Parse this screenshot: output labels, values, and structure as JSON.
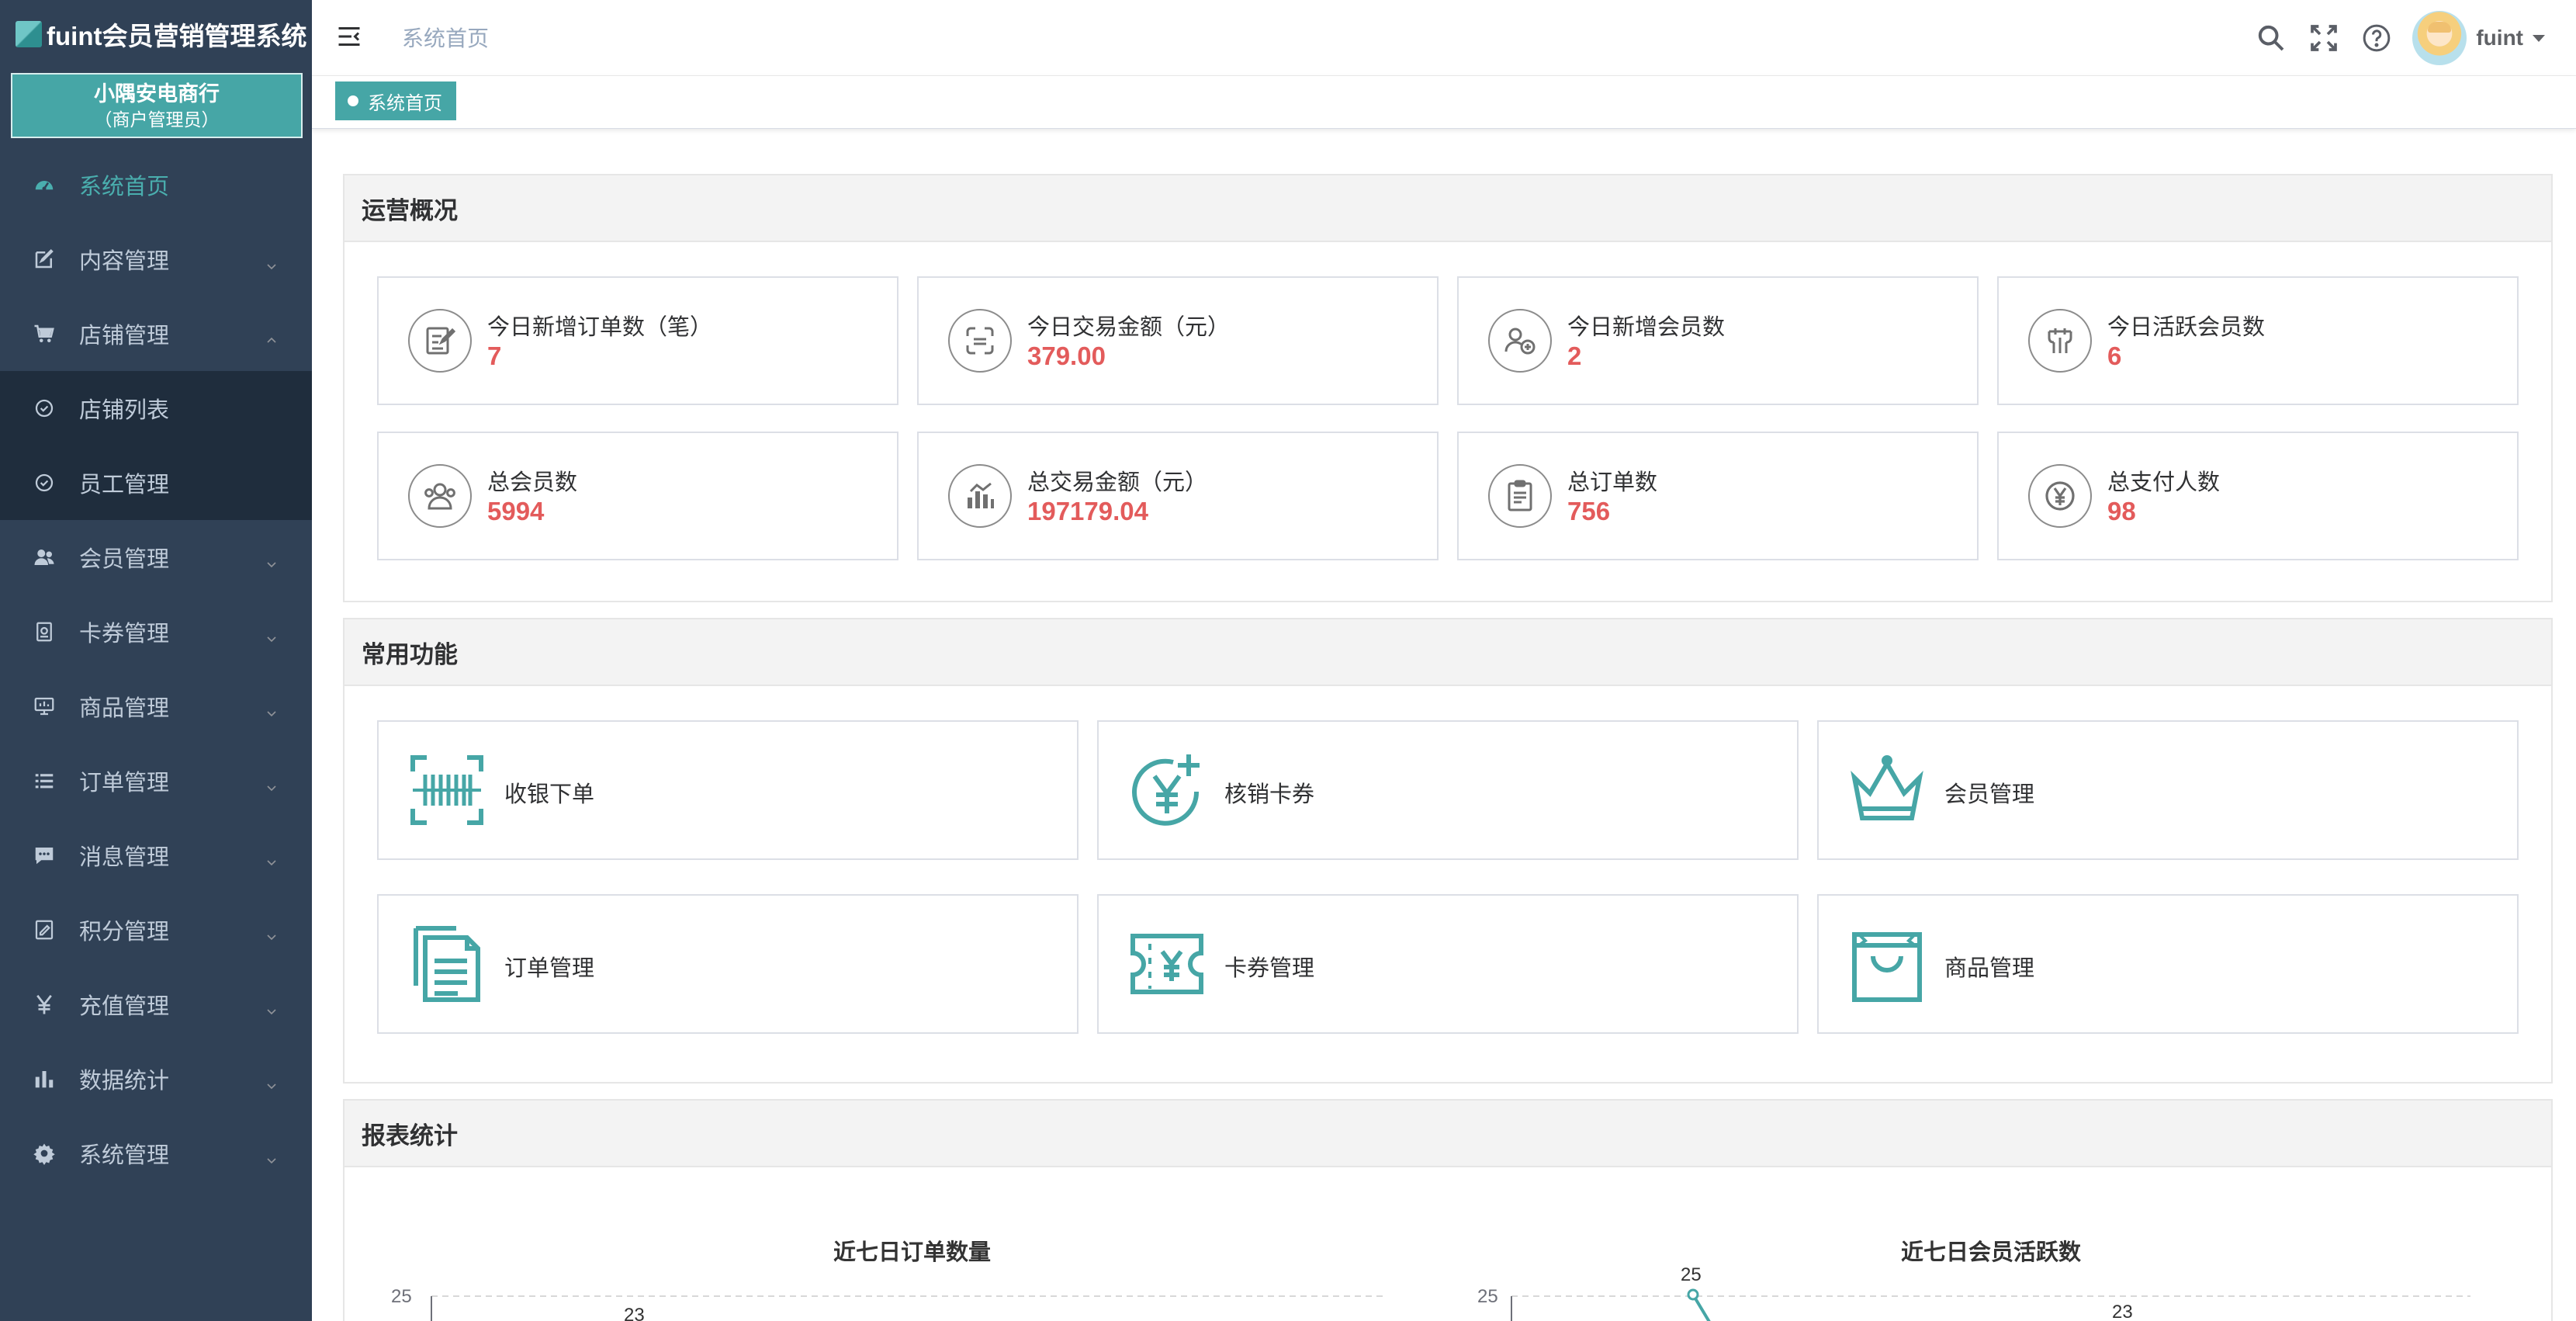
{
  "sidebar": {
    "brand": "fuint会员营销管理系统",
    "store_name": "小隅安电商行",
    "store_role": "（商户管理员）",
    "items": [
      {
        "label": "系统首页",
        "icon": "dashboard-icon"
      },
      {
        "label": "内容管理",
        "icon": "edit-icon"
      },
      {
        "label": "店铺管理",
        "icon": "cart-icon"
      },
      {
        "label": "店铺列表",
        "icon": "circle-check-icon"
      },
      {
        "label": "员工管理",
        "icon": "circle-check-icon"
      },
      {
        "label": "会员管理",
        "icon": "users-icon"
      },
      {
        "label": "卡券管理",
        "icon": "coupon-icon"
      },
      {
        "label": "商品管理",
        "icon": "monitor-icon"
      },
      {
        "label": "订单管理",
        "icon": "list-icon"
      },
      {
        "label": "消息管理",
        "icon": "message-icon"
      },
      {
        "label": "积分管理",
        "icon": "points-icon"
      },
      {
        "label": "充值管理",
        "icon": "yen-icon"
      },
      {
        "label": "数据统计",
        "icon": "bar-chart-icon"
      },
      {
        "label": "系统管理",
        "icon": "gear-icon"
      }
    ]
  },
  "navbar": {
    "breadcrumb": "系统首页",
    "username": "fuint"
  },
  "tags": {
    "active": "系统首页"
  },
  "overview": {
    "title": "运营概况",
    "cards": [
      {
        "label": "今日新增订单数（笔）",
        "value": "7"
      },
      {
        "label": "今日交易金额（元）",
        "value": "379.00"
      },
      {
        "label": "今日新增会员数",
        "value": "2"
      },
      {
        "label": "今日活跃会员数",
        "value": "6"
      },
      {
        "label": "总会员数",
        "value": "5994"
      },
      {
        "label": "总交易金额（元）",
        "value": "197179.04"
      },
      {
        "label": "总订单数",
        "value": "756"
      },
      {
        "label": "总支付人数",
        "value": "98"
      }
    ]
  },
  "functions": {
    "title": "常用功能",
    "items": [
      {
        "label": "收银下单",
        "icon": "barcode-scan-icon"
      },
      {
        "label": "核销卡券",
        "icon": "yen-plus-icon"
      },
      {
        "label": "会员管理",
        "icon": "crown-icon"
      },
      {
        "label": "订单管理",
        "icon": "document-list-icon"
      },
      {
        "label": "卡券管理",
        "icon": "ticket-icon"
      },
      {
        "label": "商品管理",
        "icon": "shopping-bag-icon"
      }
    ]
  },
  "reports": {
    "title": "报表统计"
  },
  "chart_data": [
    {
      "type": "line",
      "title": "近七日订单数量",
      "y_tick_top": "25",
      "visible_point_label": "23"
    },
    {
      "type": "line",
      "title": "近七日会员活跃数",
      "y_tick_top": "25",
      "visible_point_labels": [
        "25",
        "23"
      ]
    }
  ],
  "colors": {
    "accent": "#46a6a6",
    "value_red": "#e35b5b",
    "sidebar_bg": "#304156"
  }
}
